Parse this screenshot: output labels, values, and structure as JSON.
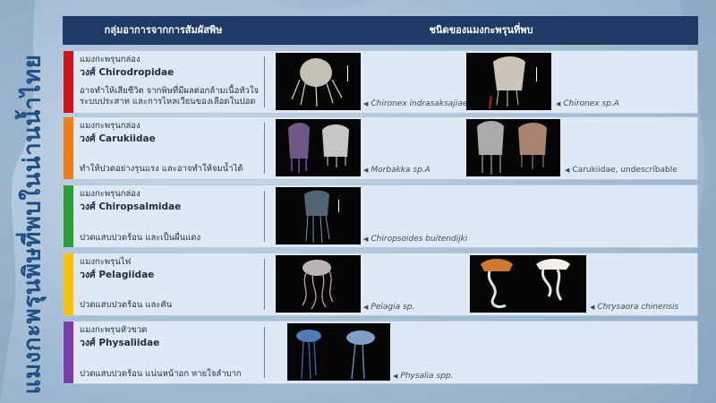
{
  "vertical_title": "แมงกะพรุนพิษที่พบในน่านน้ำไทย",
  "header": {
    "col1": "กลุ่มอาการจากการสัมผัสพิษ",
    "col2": "ชนิดของแมงกะพรุนที่พบ"
  },
  "rows": [
    {
      "color": "#d0131c",
      "type": "แมงกะพรุนกล่อง",
      "family": "วงศ์ Chirodropidae",
      "symptom": "อาจทำให้เสียชีวิต จากพิษที่มีผลต่อกล้ามเนื้อหัวใจ ระบบประสาท และการไหลเวียนของเลือดในปอด",
      "captions": [
        "Chironex indrasaksajiae",
        "Chironex sp.A"
      ]
    },
    {
      "color": "#f07d1a",
      "type": "แมงกะพรุนกล่อง",
      "family": "วงศ์ Carukiidae",
      "symptom": "ทำให้ปวดอย่างรุนแรง และอาจทำให้จมน้ำได้",
      "captions": [
        "Morbakka sp.A",
        "Carukiidae, undescribable"
      ]
    },
    {
      "color": "#2e9e3a",
      "type": "แมงกะพรุนกล่อง",
      "family": "วงศ์ Chiropsalmidae",
      "symptom": "ปวดแสบปวดร้อน และเป็นผื่นแดง",
      "captions": [
        "Chiropsoides buitendijki"
      ]
    },
    {
      "color": "#f3c20f",
      "type": "แมงกะพรุนไฟ",
      "family": "วงศ์ Pelagiidae",
      "symptom": "ปวดแสบปวดร้อน และคัน",
      "captions": [
        "Pelagia sp.",
        "Chrysaora chinensis"
      ]
    },
    {
      "color": "#7a3ea6",
      "type": "แมงกะพรุนหัวขวด",
      "family": "วงศ์ Physaliidae",
      "symptom": "ปวดแสบปวดร้อน แน่นหน้าอก หายใจลำบาก",
      "captions": [
        "Physalia spp."
      ]
    }
  ]
}
